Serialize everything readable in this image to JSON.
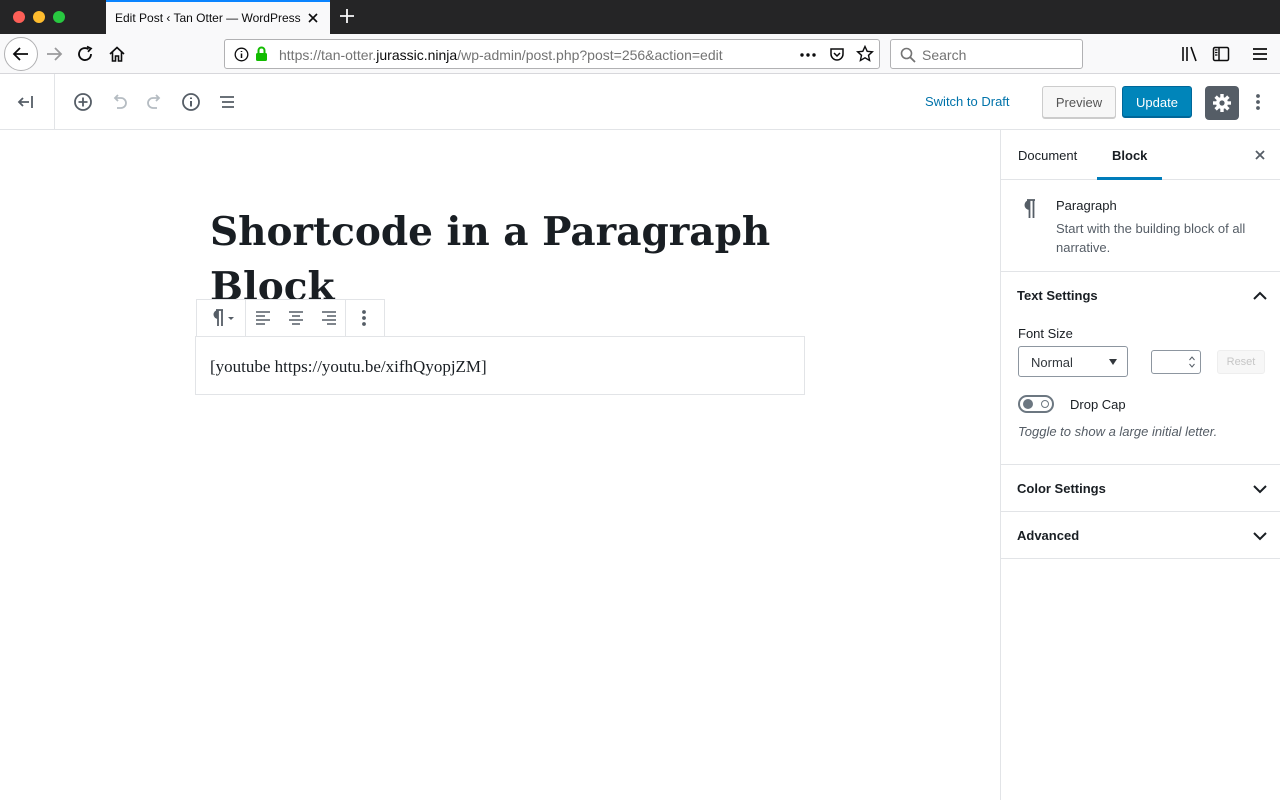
{
  "browser": {
    "tab_title": "Edit Post ‹ Tan Otter — WordPress",
    "url_prefix": "https://tan-otter.",
    "url_domain": "jurassic.ninja",
    "url_path": "/wp-admin/post.php?post=256&action=edit",
    "search_placeholder": "Search"
  },
  "header": {
    "switch_to_draft": "Switch to Draft",
    "preview": "Preview",
    "update": "Update"
  },
  "editor": {
    "title": "Shortcode in a Paragraph Block",
    "paragraph": "[youtube https://youtu.be/xifhQyopjZM]"
  },
  "sidebar": {
    "tabs": {
      "document": "Document",
      "block": "Block"
    },
    "block_card": {
      "title": "Paragraph",
      "description": "Start with the building block of all narrative."
    },
    "text_settings": {
      "title": "Text Settings",
      "font_size_label": "Font Size",
      "font_size_value": "Normal",
      "reset": "Reset",
      "drop_cap_label": "Drop Cap",
      "drop_cap_help": "Toggle to show a large initial letter."
    },
    "color_settings": {
      "title": "Color Settings"
    },
    "advanced": {
      "title": "Advanced"
    }
  },
  "colors": {
    "accent": "#0073aa",
    "update_button": "#0085ba",
    "settings_active": "#555d66"
  }
}
